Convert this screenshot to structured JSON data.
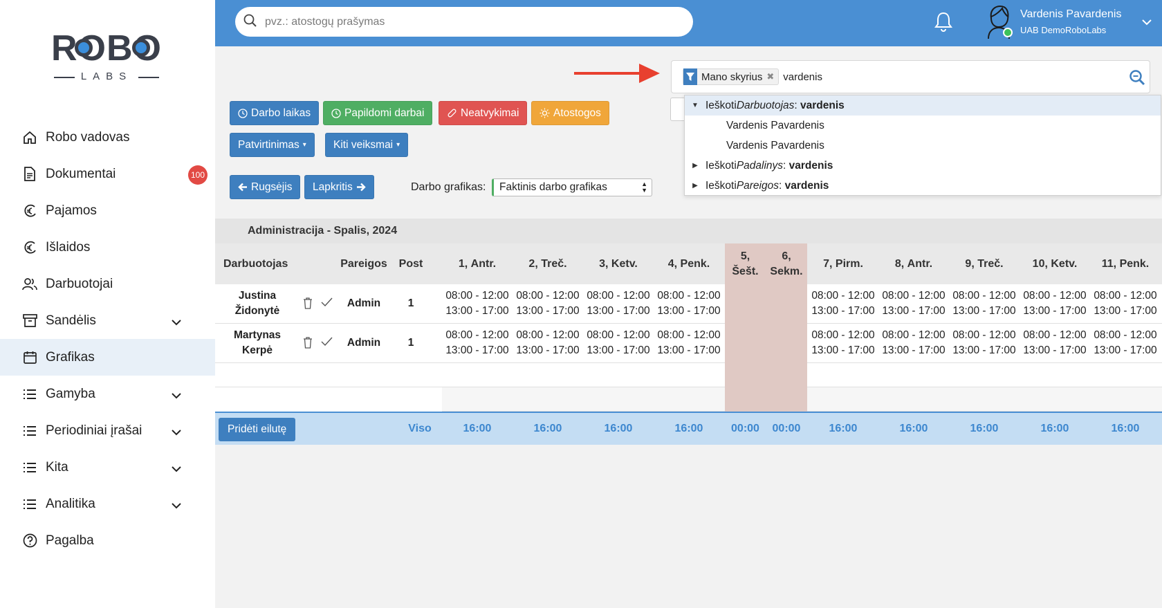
{
  "logo": {
    "word": "ROBO",
    "sub": "LABS"
  },
  "sidebar": {
    "items": [
      {
        "label": "Robo vadovas",
        "icon": "home-icon"
      },
      {
        "label": "Dokumentai",
        "icon": "document-icon",
        "badge": "100"
      },
      {
        "label": "Pajamos",
        "icon": "euro-in-icon"
      },
      {
        "label": "Išlaidos",
        "icon": "euro-out-icon"
      },
      {
        "label": "Darbuotojai",
        "icon": "users-icon"
      },
      {
        "label": "Sandėlis",
        "icon": "archive-icon",
        "expandable": true
      },
      {
        "label": "Grafikas",
        "icon": "calendar-icon",
        "active": true
      },
      {
        "label": "Gamyba",
        "icon": "list-icon",
        "expandable": true
      },
      {
        "label": "Periodiniai įrašai",
        "icon": "list-icon",
        "expandable": true
      },
      {
        "label": "Kita",
        "icon": "list-icon",
        "expandable": true
      },
      {
        "label": "Analitika",
        "icon": "list-icon",
        "expandable": true
      },
      {
        "label": "Pagalba",
        "icon": "help-icon"
      }
    ]
  },
  "header": {
    "search_placeholder": "pvz.: atostogų prašymas",
    "user_name": "Vardenis Pavardenis",
    "user_company": "UAB DemoRoboLabs"
  },
  "filter": {
    "facet_label": "Mano skyrius",
    "query": "vardenis",
    "dropdown": [
      {
        "prefix": "Ieškoti ",
        "field": "Darbuotojas",
        "term": "vardenis",
        "expanded": true
      },
      {
        "sub": "Vardenis Pavardenis"
      },
      {
        "sub": "Vardenis Pavardenis"
      },
      {
        "prefix": "Ieškoti ",
        "field": "Padalinys",
        "term": "vardenis",
        "expanded": false
      },
      {
        "prefix": "Ieškoti ",
        "field": "Pareigos",
        "term": "vardenis",
        "expanded": false
      }
    ]
  },
  "toolbar": {
    "work_time": "Darbo laikas",
    "extra_work": "Papildomi darbai",
    "absences": "Neatvykimai",
    "vacations": "Atostogos",
    "confirmation": "Patvirtinimas",
    "other_actions": "Kiti veiksmai",
    "prev_month": "Rugsėjis",
    "next_month": "Lapkritis",
    "schedule_label": "Darbo grafikas:",
    "schedule_value": "Faktinis darbo grafikas"
  },
  "colors": {
    "accent": "#4a8fd3",
    "green": "#4fae63",
    "red": "#e05452",
    "orange": "#f0a63a",
    "weekend": "#e0c9c4"
  },
  "table": {
    "department": "Administracija - Spalis, 2024",
    "headers": {
      "employee": "Darbuotojas",
      "position": "Pareigos",
      "post": "Post",
      "days": [
        {
          "num": "1,",
          "name": "Antr."
        },
        {
          "num": "2,",
          "name": "Treč."
        },
        {
          "num": "3,",
          "name": "Ketv."
        },
        {
          "num": "4,",
          "name": "Penk."
        },
        {
          "num": "5,",
          "name": "Šešt.",
          "weekend": true
        },
        {
          "num": "6,",
          "name": "Sekm.",
          "weekend": true
        },
        {
          "num": "7,",
          "name": "Pirm."
        },
        {
          "num": "8,",
          "name": "Antr."
        },
        {
          "num": "9,",
          "name": "Treč."
        },
        {
          "num": "10,",
          "name": "Ketv."
        },
        {
          "num": "11,",
          "name": "Penk."
        }
      ]
    },
    "rows": [
      {
        "first": "Justina",
        "last": "Židonytė",
        "position": "Admin",
        "post": "1",
        "shift1": "08:00 - 12:00",
        "shift2": "13:00 - 17:00"
      },
      {
        "first": "Martynas",
        "last": "Kerpė",
        "position": "Admin",
        "post": "1",
        "shift1": "08:00 - 12:00",
        "shift2": "13:00 - 17:00"
      }
    ],
    "add_row": "Pridėti eilutę",
    "total_label": "Viso",
    "totals": [
      "16:00",
      "16:00",
      "16:00",
      "16:00",
      "00:00",
      "00:00",
      "16:00",
      "16:00",
      "16:00",
      "16:00",
      "16:00"
    ]
  }
}
